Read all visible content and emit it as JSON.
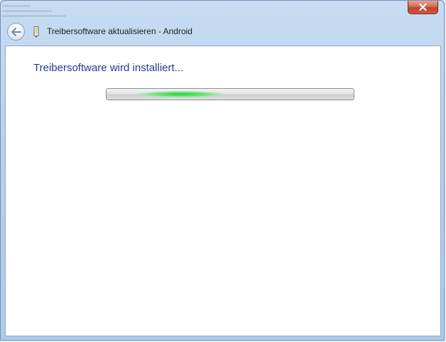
{
  "window": {
    "title": "Treibersoftware aktualisieren - Android",
    "close_label": "Schließen",
    "back_label": "Zurück"
  },
  "content": {
    "heading": "Treibersoftware wird installiert..."
  },
  "progress": {
    "mode": "marquee",
    "color": "#27d33a"
  },
  "colors": {
    "heading": "#1e3b93",
    "frame": "#b9d2ec",
    "close_button": "#c1402a"
  }
}
